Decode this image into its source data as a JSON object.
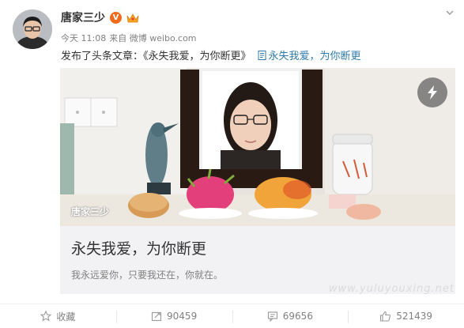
{
  "author": {
    "name": "唐家三少",
    "verified_badge": "V"
  },
  "meta": {
    "time": "今天 11:08",
    "source": "来自 微博 weibo.com"
  },
  "post": {
    "prefix_text": "发布了头条文章：《永失我爱，为你断更》",
    "link_text": "永失我爱，为你断更"
  },
  "article": {
    "image_badge": "唐家三少",
    "title": "永失我爱，为你断更",
    "summary": "我永远爱你，只要我还在，你就在。"
  },
  "footer": {
    "collect_label": "收藏",
    "repost_count": "90459",
    "comment_count": "69656",
    "like_count": "521439"
  },
  "watermark": "www.yuluyouxing.net",
  "colors": {
    "link": "#2f7ba8",
    "verified": "#f26a1b",
    "muted": "#808080"
  }
}
